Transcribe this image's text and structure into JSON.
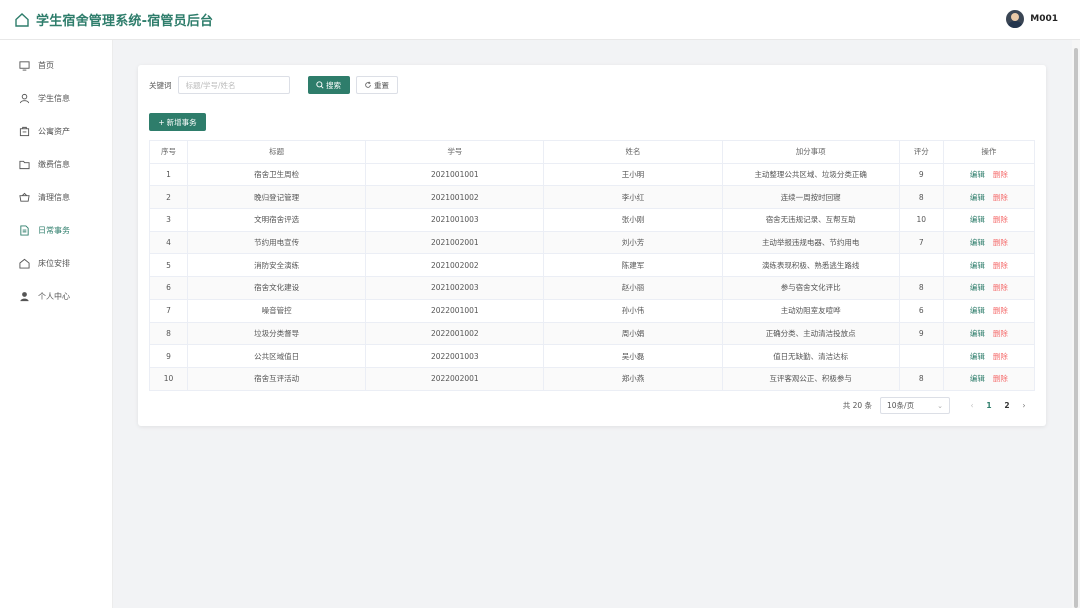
{
  "app": {
    "title": "学生宿舍管理系统-宿管员后台",
    "user": "M001"
  },
  "sidebar": {
    "items": [
      {
        "label": "首页",
        "icon": "monitor-icon"
      },
      {
        "label": "学生信息",
        "icon": "user-icon"
      },
      {
        "label": "公寓资产",
        "icon": "briefcase-icon"
      },
      {
        "label": "缴费信息",
        "icon": "folder-icon"
      },
      {
        "label": "清理信息",
        "icon": "basket-icon"
      },
      {
        "label": "日常事务",
        "icon": "document-icon",
        "active": true
      },
      {
        "label": "床位安排",
        "icon": "home-icon"
      },
      {
        "label": "个人中心",
        "icon": "person-icon"
      }
    ]
  },
  "search": {
    "label": "关键词",
    "placeholder": "标题/学号/姓名",
    "value": "",
    "search_button": "搜索",
    "reset_button": "重置"
  },
  "toolbar": {
    "add_button": "新增事务"
  },
  "table": {
    "headers": [
      "序号",
      "标题",
      "学号",
      "姓名",
      "加分事项",
      "评分",
      "操作"
    ],
    "rows": [
      [
        "1",
        "宿舍卫生周检",
        "2021001001",
        "王小明",
        "主动整理公共区域、垃圾分类正确",
        "9"
      ],
      [
        "2",
        "晚归登记管理",
        "2021001002",
        "李小红",
        "连续一周按时回寝",
        "8"
      ],
      [
        "3",
        "文明宿舍评选",
        "2021001003",
        "张小刚",
        "宿舍无违规记录、互帮互助",
        "10"
      ],
      [
        "4",
        "节约用电宣传",
        "2021002001",
        "刘小芳",
        "主动举报违规电器、节约用电",
        "7"
      ],
      [
        "5",
        "消防安全演练",
        "2021002002",
        "陈建军",
        "演练表现积极、熟悉逃生路线",
        ""
      ],
      [
        "6",
        "宿舍文化建设",
        "2021002003",
        "赵小丽",
        "参与宿舍文化评比",
        "8"
      ],
      [
        "7",
        "噪音管控",
        "2022001001",
        "孙小伟",
        "主动劝阻室友喧哗",
        "6"
      ],
      [
        "8",
        "垃圾分类督导",
        "2022001002",
        "周小娟",
        "正确分类、主动清洁投放点",
        "9"
      ],
      [
        "9",
        "公共区域值日",
        "2022001003",
        "吴小磊",
        "值日无缺勤、清洁达标",
        ""
      ],
      [
        "10",
        "宿舍互评活动",
        "2022002001",
        "郑小燕",
        "互评客观公正、积极参与",
        "8"
      ]
    ],
    "edit_label": "编辑",
    "delete_label": "删除"
  },
  "pagination": {
    "total": "共 20 条",
    "page_size": "10条/页",
    "pages": [
      "1",
      "2"
    ],
    "current": "1"
  },
  "colors": {
    "accent": "#2e7d6b",
    "danger": "#f56c6c"
  }
}
